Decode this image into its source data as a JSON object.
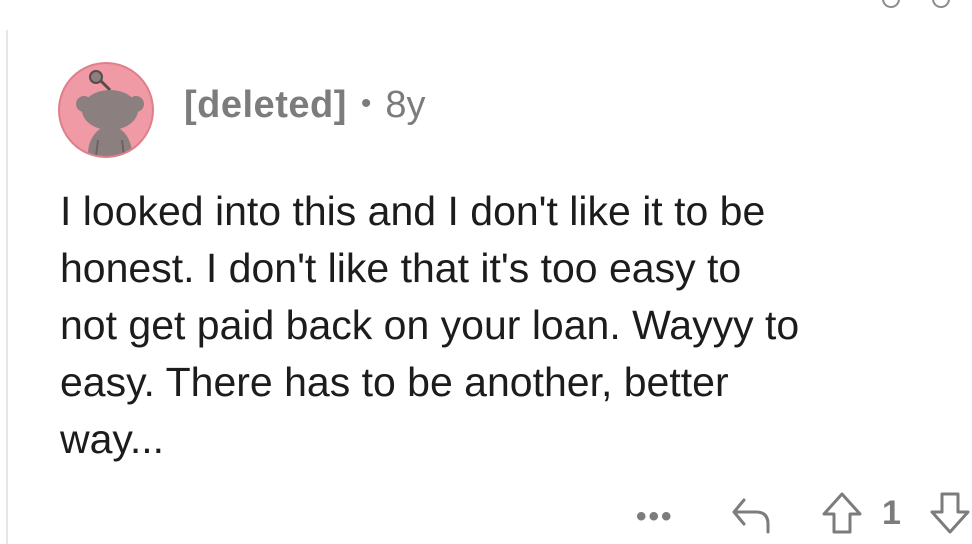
{
  "comment": {
    "author": "[deleted]",
    "separator": "•",
    "age": "8y",
    "body": "I looked into this and I don't like it to be\nhonest. I don't like that it's too easy to\nnot get paid back on your loan. Wayyy to\neasy. There has to be another, better\nway...",
    "vote_count": "1",
    "more_label": "•••"
  },
  "icons": {
    "avatar": "snoo-avatar-icon",
    "more": "more-icon",
    "reply": "reply-icon",
    "upvote": "upvote-icon",
    "downvote": "downvote-icon"
  },
  "colors": {
    "avatar_bg": "#ef9aa4",
    "text": "#1c1c1c",
    "meta": "#7c7c7c"
  }
}
